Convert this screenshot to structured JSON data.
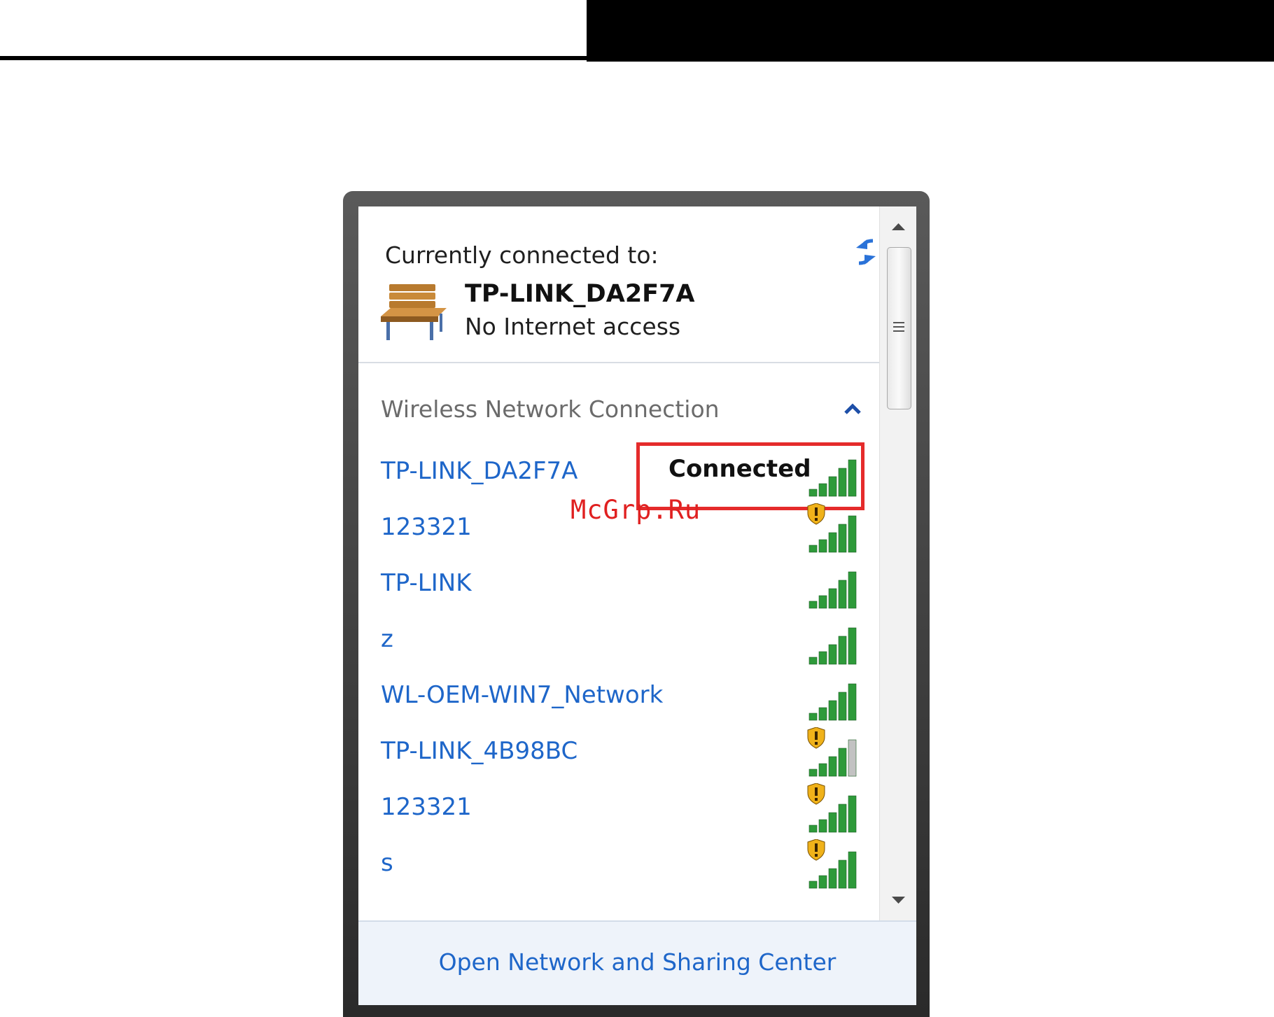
{
  "panel": {
    "header_label": "Currently connected to:",
    "current_network": {
      "name": "TP-LINK_DA2F7A",
      "status": "No Internet access",
      "icon": "bench-icon"
    },
    "refresh_icon": "refresh-arrows-icon",
    "section": {
      "title": "Wireless Network Connection",
      "collapse_icon": "chevron-up-icon"
    },
    "networks": [
      {
        "name": "TP-LINK_DA2F7A",
        "status": "Connected",
        "signal_bars": 5,
        "secured_warning": false,
        "highlighted": true
      },
      {
        "name": "123321",
        "status": "",
        "signal_bars": 5,
        "secured_warning": true,
        "highlighted": false
      },
      {
        "name": "TP-LINK",
        "status": "",
        "signal_bars": 5,
        "secured_warning": false,
        "highlighted": false
      },
      {
        "name": "z",
        "status": "",
        "signal_bars": 5,
        "secured_warning": false,
        "highlighted": false
      },
      {
        "name": "WL-OEM-WIN7_Network",
        "status": "",
        "signal_bars": 5,
        "secured_warning": false,
        "highlighted": false
      },
      {
        "name": "TP-LINK_4B98BC",
        "status": "",
        "signal_bars": 4,
        "secured_warning": true,
        "highlighted": false
      },
      {
        "name": "123321",
        "status": "",
        "signal_bars": 5,
        "secured_warning": true,
        "highlighted": false
      },
      {
        "name": "s",
        "status": "",
        "signal_bars": 5,
        "secured_warning": true,
        "highlighted": false
      }
    ],
    "footer_link": "Open Network and Sharing Center"
  },
  "watermark": "McGrp.Ru",
  "colors": {
    "link": "#1e66c9",
    "signal_on": "#2e9a3a",
    "signal_off": "#c2c2c2",
    "highlight": "#e52b2b"
  }
}
